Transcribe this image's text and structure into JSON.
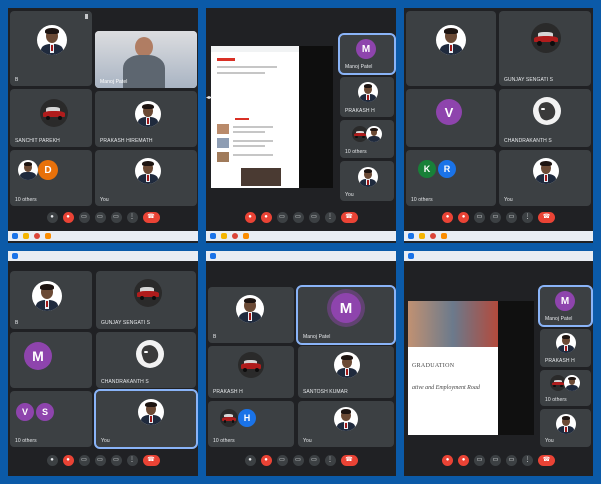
{
  "colors": {
    "frame": "#0b5aa8",
    "meet_bg": "#202124",
    "tile_bg": "#3c4043",
    "avatar_purple": "#8e44ad",
    "avatar_orange": "#e8710a",
    "avatar_green": "#188038",
    "avatar_blue": "#1a73e8",
    "end_call_red": "#ea4335"
  },
  "icons": {
    "controls": [
      "camera-icon",
      "mic-off-icon",
      "captions-icon",
      "present-icon",
      "raise-hand-icon",
      "more-icon",
      "end-call-icon"
    ],
    "taskbar": [
      "windows-icon",
      "folder-icon",
      "chrome-icon",
      "media-icon",
      "zoom-icon"
    ]
  },
  "panel1": {
    "tiles": [
      {
        "name": "B"
      },
      {
        "name": "Manoj Patel"
      },
      {
        "name": "SANCHIT PAREKH"
      },
      {
        "name": "PRAKASH HIREMATH"
      },
      {
        "name": "10 others",
        "initial": "D"
      },
      {
        "name": "You"
      }
    ]
  },
  "panel2": {
    "tiles": [
      {
        "name": "Manoj Patel",
        "initial": "M"
      },
      {
        "name": "PRAKASH H"
      },
      {
        "name": "10 others"
      },
      {
        "name": "You"
      }
    ]
  },
  "panel3": {
    "tiles": [
      {
        "name": ""
      },
      {
        "name": "GUNJAY SENGATI S"
      },
      {
        "name": "",
        "initial": "V"
      },
      {
        "name": "CHANDRAKANTH S"
      },
      {
        "name": "10 others",
        "initials": [
          "K",
          "R"
        ]
      },
      {
        "name": "You"
      }
    ]
  },
  "panel4": {
    "tiles": [
      {
        "name": "B"
      },
      {
        "name": "GUNJAY SENGATI S"
      },
      {
        "name": "",
        "initial": "M"
      },
      {
        "name": "CHANDRAKANTH S"
      },
      {
        "name": "10 others",
        "initials": [
          "V",
          "S"
        ]
      },
      {
        "name": "You"
      }
    ]
  },
  "panel5": {
    "tiles": [
      {
        "name": "B"
      },
      {
        "name": "Manoj Patel",
        "initial": "M"
      },
      {
        "name": "PRAKASH H"
      },
      {
        "name": "SANTOSH KUMAR"
      },
      {
        "name": "10 others",
        "initial": "H"
      },
      {
        "name": "You"
      }
    ]
  },
  "panel6": {
    "slide": {
      "heading": "GRADUATION",
      "subtitle": "ative and Employment Road"
    },
    "tiles": [
      {
        "name": "Manoj Patel",
        "initial": "M"
      },
      {
        "name": "PRAKASH H"
      },
      {
        "name": "10 others"
      },
      {
        "name": "You"
      }
    ]
  }
}
